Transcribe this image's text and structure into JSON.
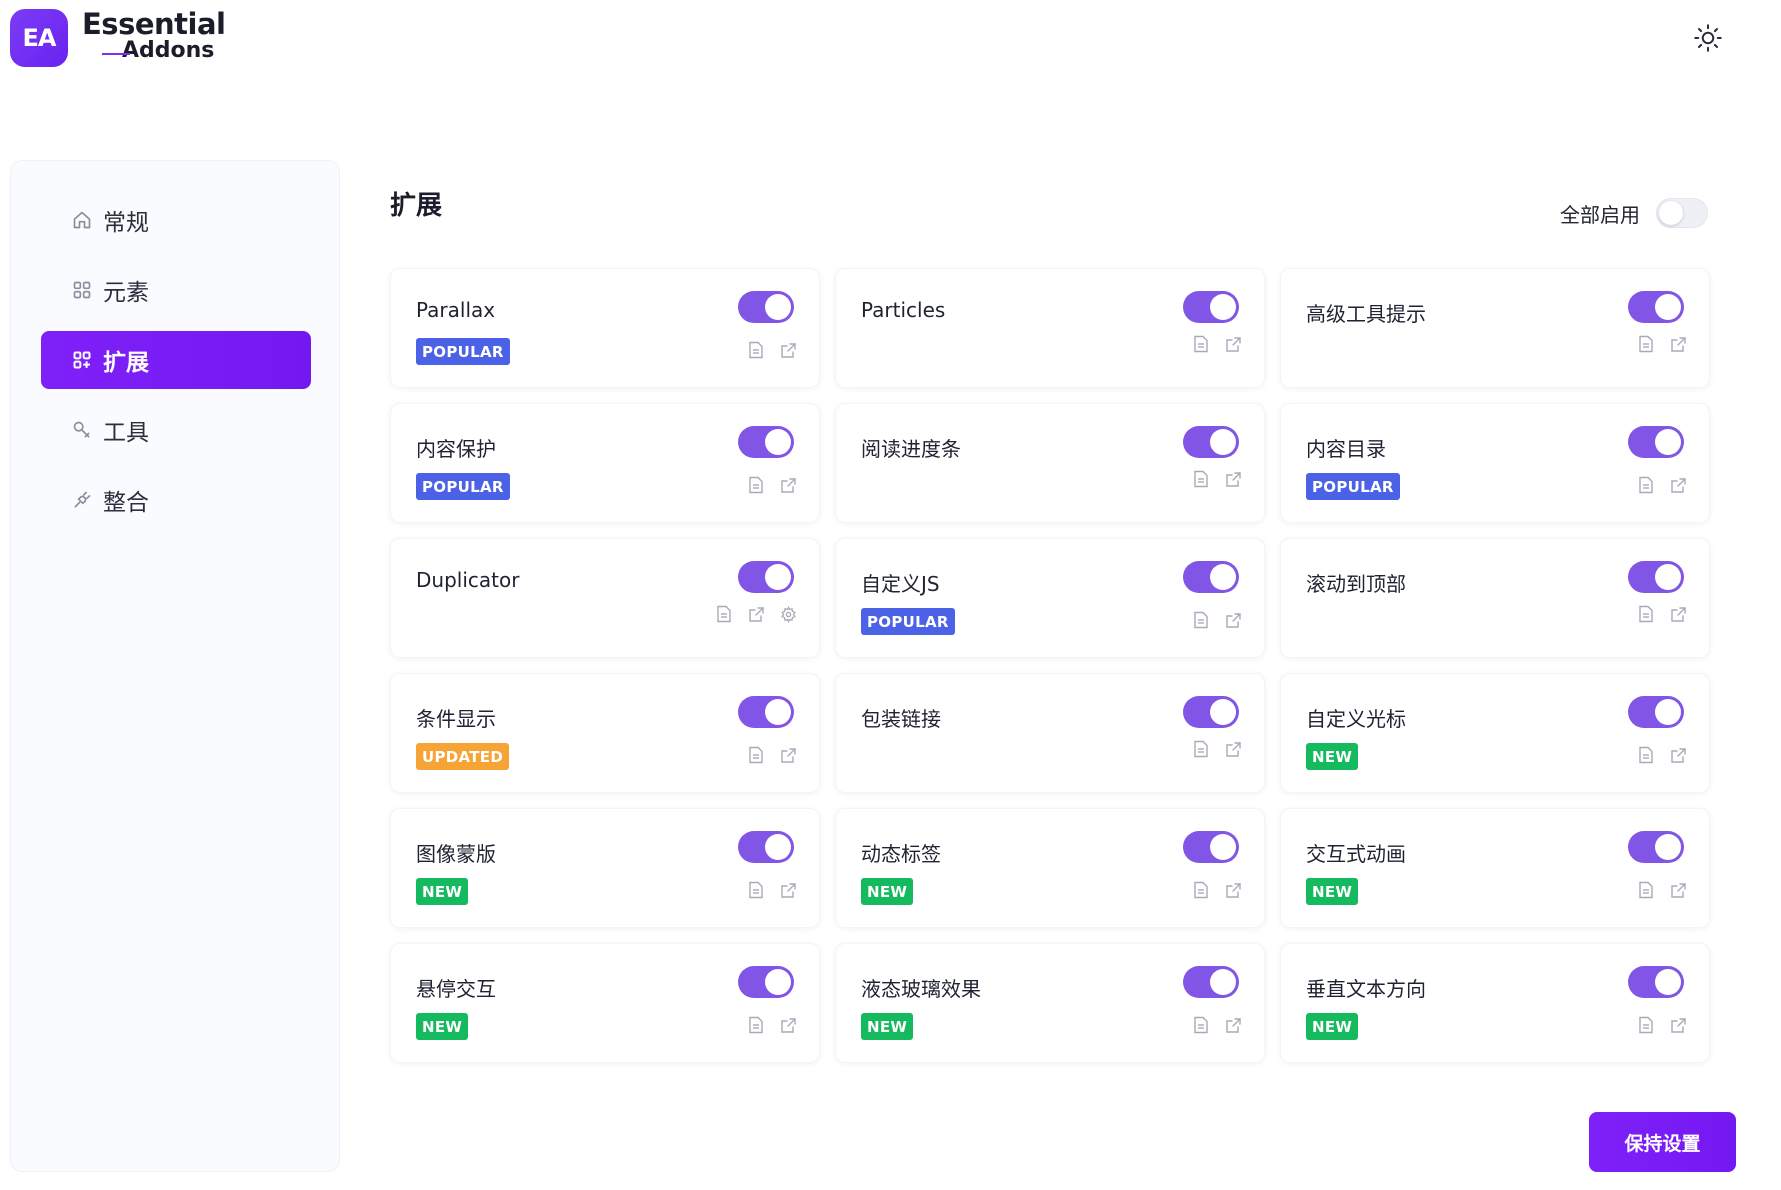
{
  "brand": {
    "line1": "Essential",
    "line2": "Addons",
    "mark": "EA"
  },
  "sidebar": {
    "items": [
      {
        "label": "常规",
        "icon": "home-icon",
        "active": false
      },
      {
        "label": "元素",
        "icon": "grid-icon",
        "active": false
      },
      {
        "label": "扩展",
        "icon": "extension-icon",
        "active": true
      },
      {
        "label": "工具",
        "icon": "tool-icon",
        "active": false
      },
      {
        "label": "整合",
        "icon": "plug-icon",
        "active": false
      }
    ]
  },
  "main": {
    "title": "扩展",
    "enable_all_label": "全部启用",
    "enable_all_on": false,
    "cards": [
      {
        "title": "Parallax",
        "badge": "POPULAR",
        "badge_type": "popular",
        "enabled": true,
        "settings": false
      },
      {
        "title": "Particles",
        "badge": "",
        "badge_type": "",
        "enabled": true,
        "settings": false
      },
      {
        "title": "高级工具提示",
        "badge": "",
        "badge_type": "",
        "enabled": true,
        "settings": false
      },
      {
        "title": "内容保护",
        "badge": "POPULAR",
        "badge_type": "popular",
        "enabled": true,
        "settings": false
      },
      {
        "title": "阅读进度条",
        "badge": "",
        "badge_type": "",
        "enabled": true,
        "settings": false
      },
      {
        "title": "内容目录",
        "badge": "POPULAR",
        "badge_type": "popular",
        "enabled": true,
        "settings": false
      },
      {
        "title": "Duplicator",
        "badge": "",
        "badge_type": "",
        "enabled": true,
        "settings": true
      },
      {
        "title": "自定义JS",
        "badge": "POPULAR",
        "badge_type": "popular",
        "enabled": true,
        "settings": false
      },
      {
        "title": "滚动到顶部",
        "badge": "",
        "badge_type": "",
        "enabled": true,
        "settings": false
      },
      {
        "title": "条件显示",
        "badge": "UPDATED",
        "badge_type": "updated",
        "enabled": true,
        "settings": false
      },
      {
        "title": "包装链接",
        "badge": "",
        "badge_type": "",
        "enabled": true,
        "settings": false
      },
      {
        "title": "自定义光标",
        "badge": "NEW",
        "badge_type": "new",
        "enabled": true,
        "settings": false
      },
      {
        "title": "图像蒙版",
        "badge": "NEW",
        "badge_type": "new",
        "enabled": true,
        "settings": false
      },
      {
        "title": "动态标签",
        "badge": "NEW",
        "badge_type": "new",
        "enabled": true,
        "settings": false
      },
      {
        "title": "交互式动画",
        "badge": "NEW",
        "badge_type": "new",
        "enabled": true,
        "settings": false
      },
      {
        "title": "悬停交互",
        "badge": "NEW",
        "badge_type": "new",
        "enabled": true,
        "settings": false
      },
      {
        "title": "液态玻璃效果",
        "badge": "NEW",
        "badge_type": "new",
        "enabled": true,
        "settings": false
      },
      {
        "title": "垂直文本方向",
        "badge": "NEW",
        "badge_type": "new",
        "enabled": true,
        "settings": false
      }
    ]
  },
  "save_label": "保持设置",
  "colors": {
    "accent": "#7b1ff5",
    "toggle_on": "#8155e6",
    "popular": "#4b62e6",
    "new": "#16ba5e",
    "updated": "#f7a436"
  }
}
